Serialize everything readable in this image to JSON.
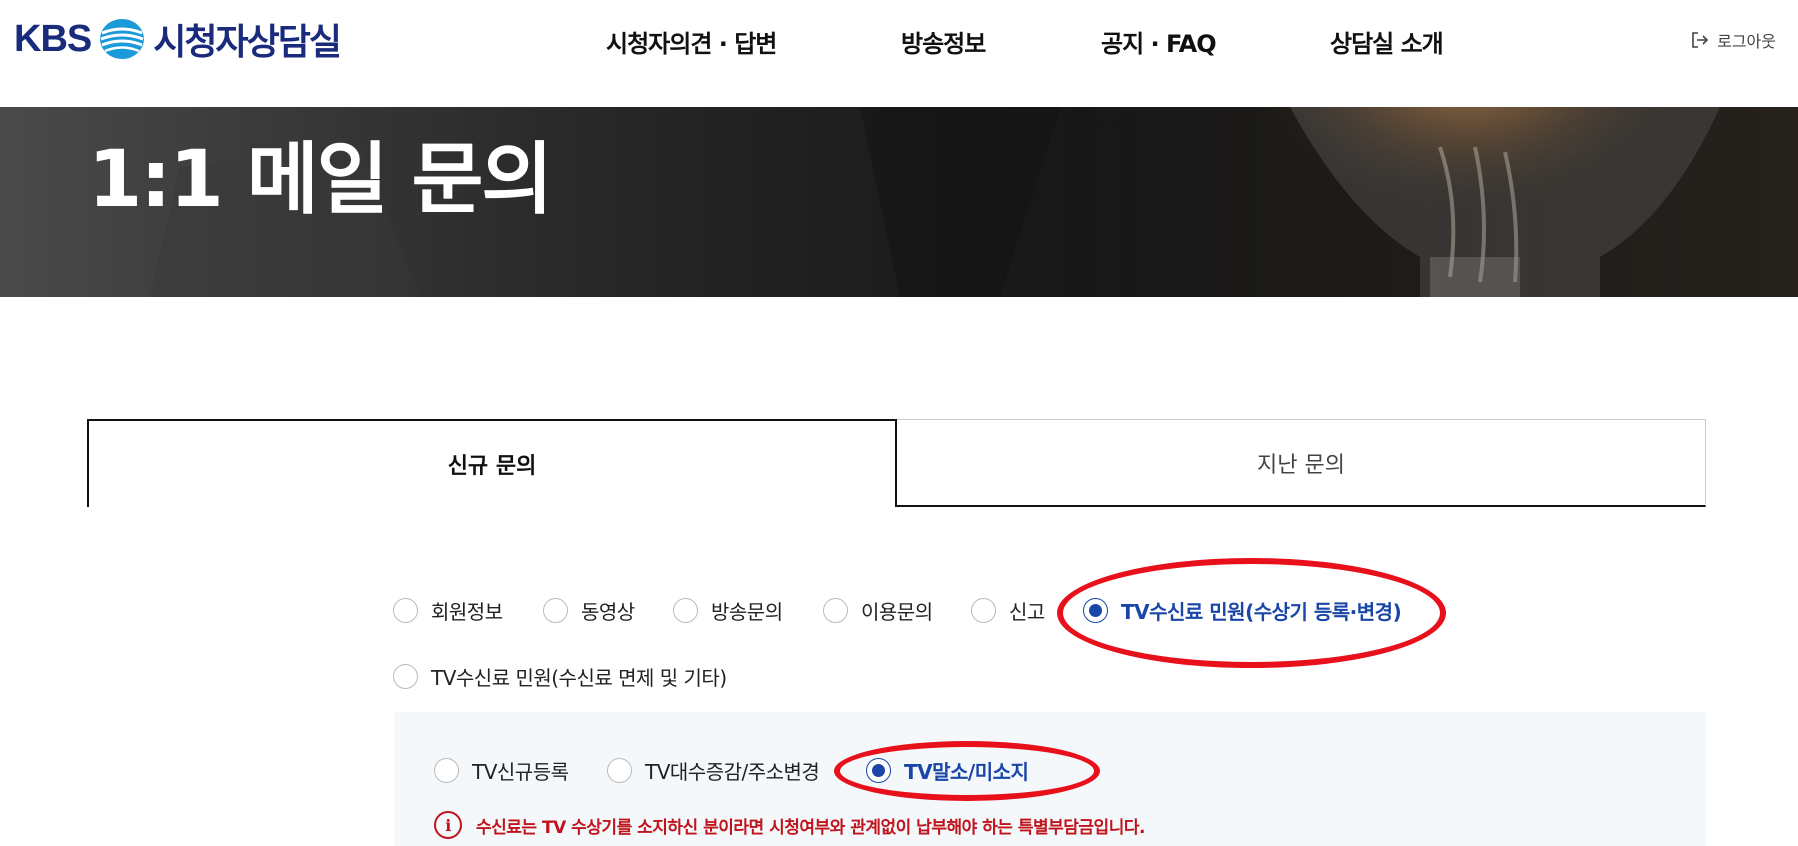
{
  "header": {
    "logo_text": "KBS",
    "site_title": "시청자상담실",
    "nav": [
      "시청자의견 · 답변",
      "방송정보",
      "공지 · FAQ",
      "상담실 소개"
    ],
    "logout_label": "로그아웃"
  },
  "banner": {
    "title": "1:1 메일 문의"
  },
  "tabs": {
    "new_label": "신규 문의",
    "past_label": "지난 문의",
    "active": "신규 문의"
  },
  "categories": {
    "options": [
      "회원정보",
      "동영상",
      "방송문의",
      "이용문의",
      "신고",
      "TV수신료 민원(수상기 등록·변경)",
      "TV수신료 민원(수신료 면제 및 기타)"
    ],
    "selected": "TV수신료 민원(수상기 등록·변경)"
  },
  "subcategories": {
    "options": [
      "TV신규등록",
      "TV대수증감/주소변경",
      "TV말소/미소지"
    ],
    "selected": "TV말소/미소지"
  },
  "notice": {
    "icon": "info-icon",
    "text": "수신료는 TV 수상기를 소지하신 분이라면 시청여부와 관계없이 납부해야 하는 특별부담금입니다."
  },
  "colors": {
    "brand": "#1a2a7c",
    "selected": "#1a46a8",
    "warning": "#c0131b",
    "annotation": "#e8101a"
  }
}
